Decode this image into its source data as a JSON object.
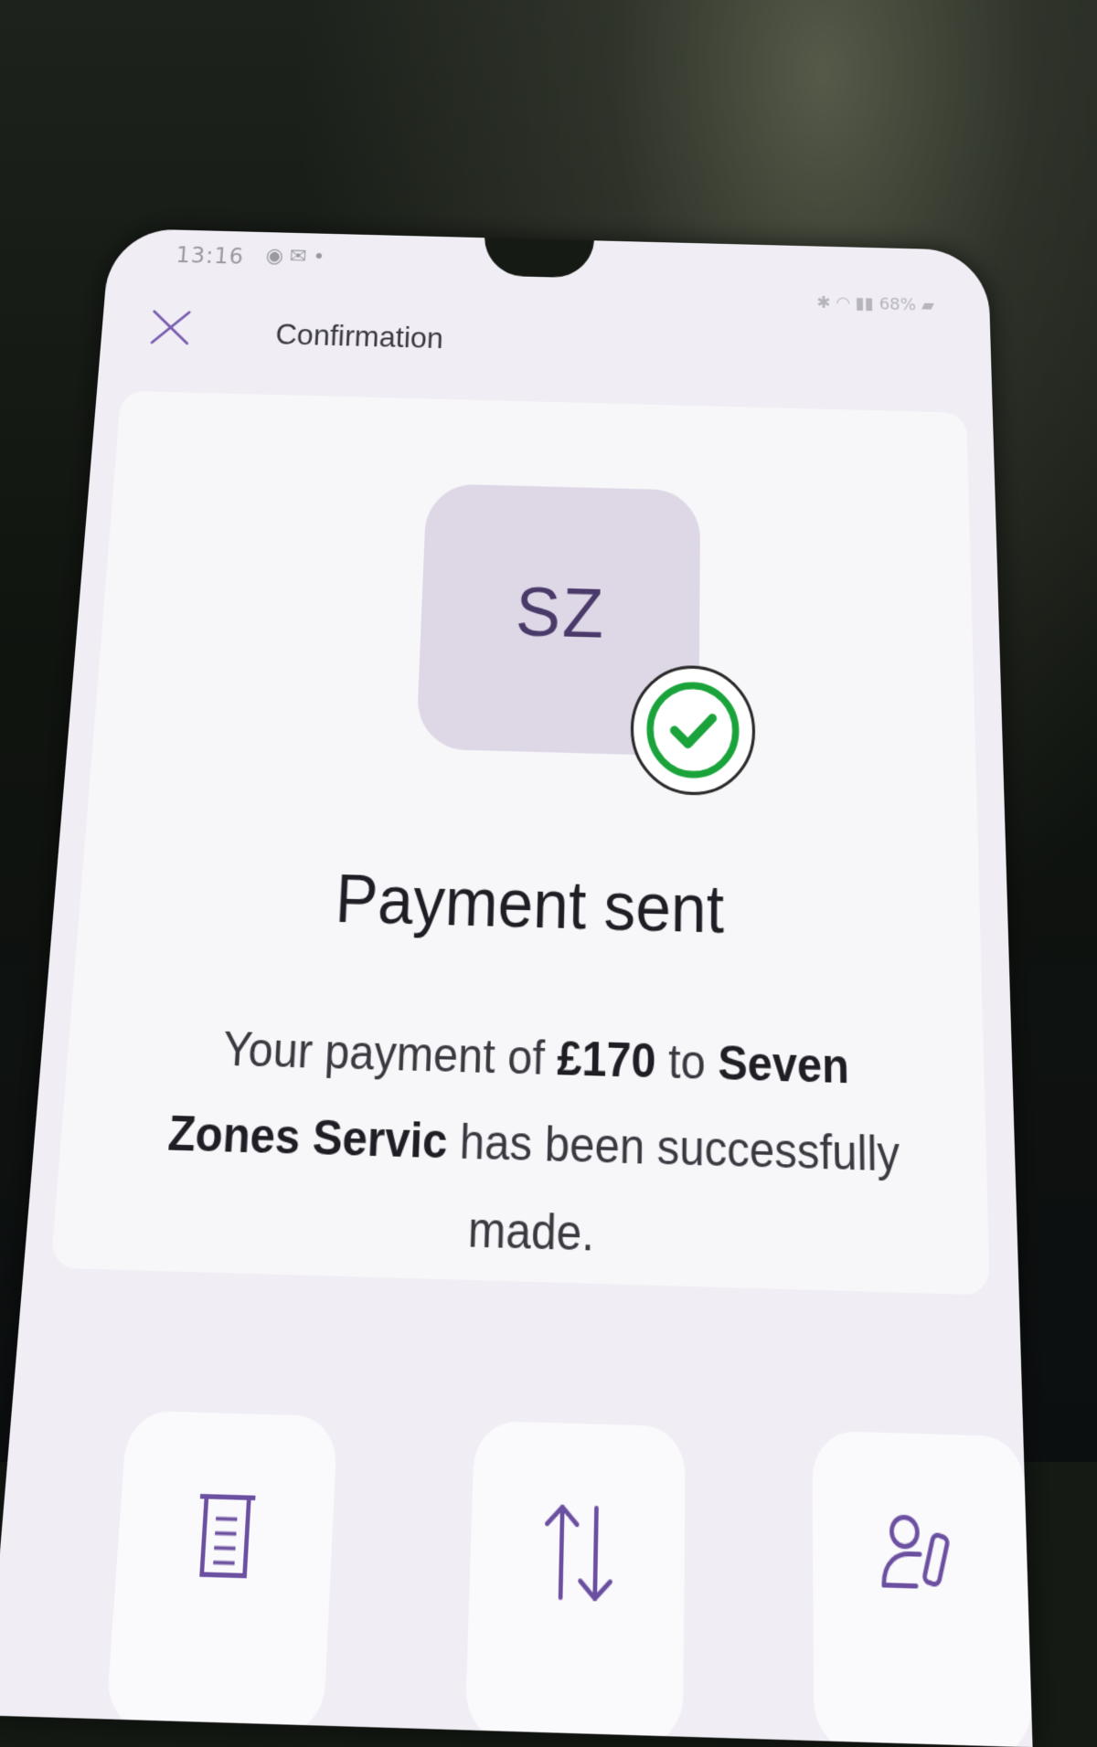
{
  "status_bar": {
    "time": "13:16",
    "notifications": "◉ ✉ •",
    "battery": "68%"
  },
  "header": {
    "title": "Confirmation",
    "close_icon": "close-icon"
  },
  "payee": {
    "initials": "SZ"
  },
  "confirmation": {
    "title": "Payment sent",
    "message_prefix": "Your payment of ",
    "amount": "£170",
    "message_middle": " to ",
    "payee_name": "Seven Zones Servic",
    "message_suffix": " has been successfully made."
  },
  "actions": [
    {
      "icon": "receipt-icon"
    },
    {
      "icon": "transfer-arrows-icon"
    },
    {
      "icon": "edit-payee-icon"
    }
  ],
  "colors": {
    "accent_purple": "#6b4fa0",
    "success_green": "#1aa33a",
    "avatar_bg": "#ddd7e6"
  }
}
